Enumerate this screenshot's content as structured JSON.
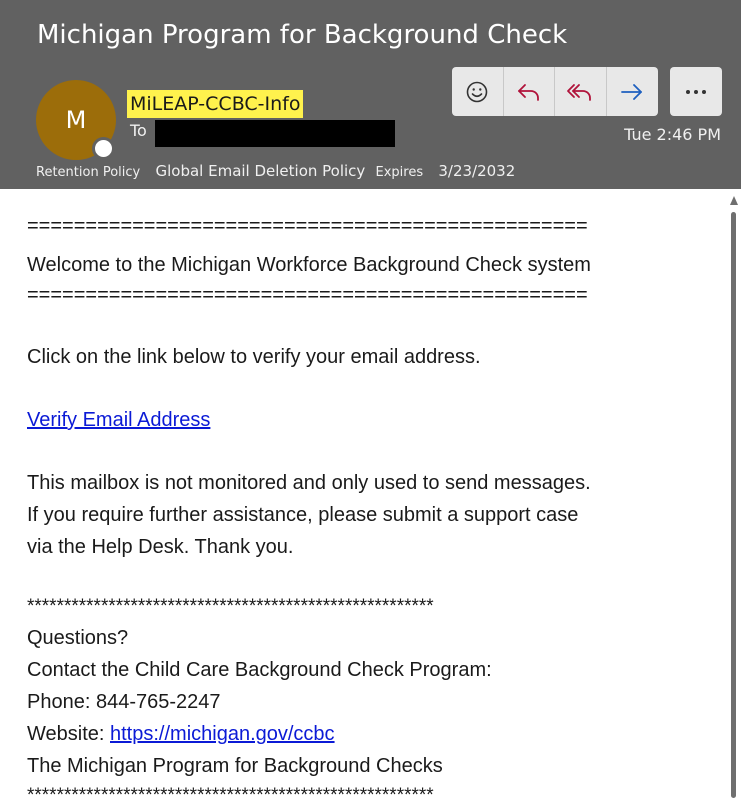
{
  "email": {
    "subject": "Michigan Program for Background Check",
    "avatar_initial": "M",
    "sender": "MiLEAP-CCBC-Info",
    "to_label": "To",
    "date": "Tue 2:46 PM",
    "retention": {
      "label": "Retention Policy",
      "policy": "Global Email Deletion Policy",
      "expires_label": "Expires",
      "expires_date": "3/23/2032"
    }
  },
  "toolbar": {
    "icons": [
      "emoji-icon",
      "reply-icon",
      "reply-all-icon",
      "forward-icon",
      "more-icon"
    ]
  },
  "body": {
    "separator": "================================================",
    "welcome": "Welcome to the Michigan Workforce Background Check system",
    "instruction": "Click on the link below to verify your email address.",
    "verify_link": "Verify Email Address",
    "notice_1": "This mailbox is not monitored and only used to send messages.",
    "notice_2": "If you require further assistance, please submit a support case",
    "notice_3": "via the Help Desk. Thank you.",
    "stars": "*******************************************************",
    "questions": "Questions?",
    "contact": "Contact the Child Care Background Check Program:",
    "phone": "Phone: 844-765-2247",
    "website_label": "Website: ",
    "website_link": "https://michigan.gov/ccbc",
    "program": "The Michigan Program for Background Checks"
  },
  "colors": {
    "header_bg": "#616161",
    "avatar_bg": "#9c6d0a",
    "sender_highlight": "#fff24d",
    "link": "#0b1ad6",
    "button_bg": "#e8e8e8",
    "icon_accent": "#b0123a",
    "forward_accent": "#1e5fbf"
  }
}
